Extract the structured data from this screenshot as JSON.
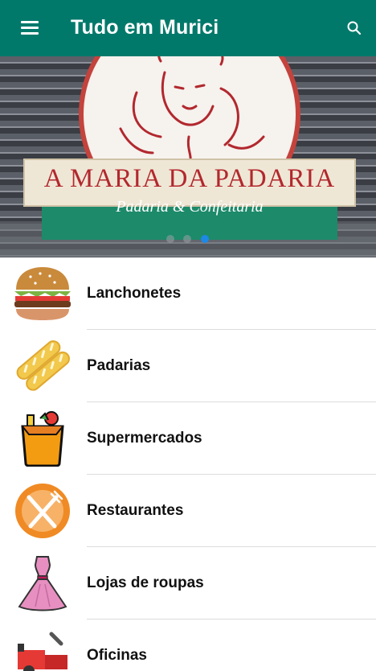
{
  "app_bar": {
    "title": "Tudo em Murici",
    "menu_icon": "hamburger-menu-icon",
    "search_icon": "search-icon",
    "color": "#00796b"
  },
  "banner": {
    "sign_title": "A MARIA DA PADARIA",
    "sign_subtitle": "Padaria & Confeitaria",
    "carousel": {
      "page_count": 3,
      "active_index": 2,
      "active_color": "#1e88e5"
    }
  },
  "categories": [
    {
      "label": "Lanchonetes",
      "icon": "hamburger-icon"
    },
    {
      "label": "Padarias",
      "icon": "bread-icon"
    },
    {
      "label": "Supermercados",
      "icon": "grocery-bag-icon"
    },
    {
      "label": "Restaurantes",
      "icon": "fork-knife-icon"
    },
    {
      "label": "Lojas de roupas",
      "icon": "dress-icon"
    },
    {
      "label": "Oficinas",
      "icon": "car-repair-icon"
    }
  ]
}
